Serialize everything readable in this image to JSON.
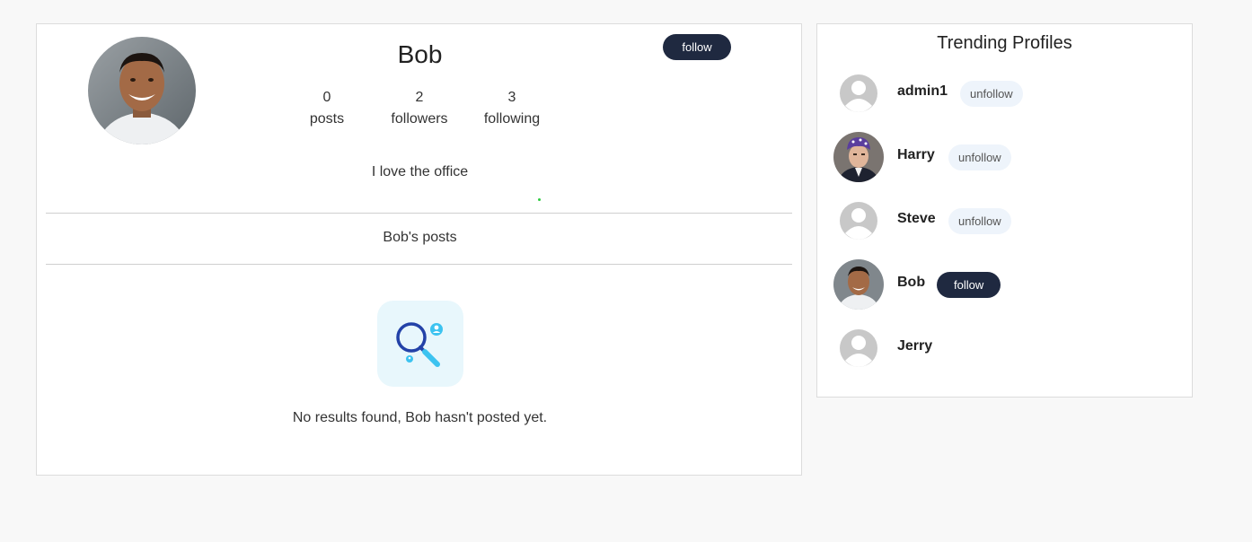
{
  "profile": {
    "name": "Bob",
    "follow_label": "follow",
    "stats": [
      {
        "value": "0",
        "label": "posts"
      },
      {
        "value": "2",
        "label": "followers"
      },
      {
        "value": "3",
        "label": "following"
      }
    ],
    "bio": "I love the office",
    "posts_heading": "Bob's posts",
    "empty_message": "No results found, Bob hasn't posted yet."
  },
  "trending": {
    "title": "Trending Profiles",
    "profiles": [
      {
        "name": "admin1",
        "avatar": "default-avatar",
        "action": "unfollow"
      },
      {
        "name": "Harry",
        "avatar": "photo-avatar",
        "action": "unfollow"
      },
      {
        "name": "Steve",
        "avatar": "default-avatar",
        "action": "unfollow"
      },
      {
        "name": "Bob",
        "avatar": "photo-avatar",
        "action": "follow"
      },
      {
        "name": "Jerry",
        "avatar": "default-avatar",
        "action": ""
      }
    ]
  },
  "colors": {
    "page_bg": "#f8f8f8",
    "follow_bg": "#1f2940",
    "unfollow_bg": "#eef4fb",
    "empty_icon_bg": "#e8f7fc",
    "accent_blue": "#2342a8",
    "accent_cyan": "#3cc3f0"
  }
}
